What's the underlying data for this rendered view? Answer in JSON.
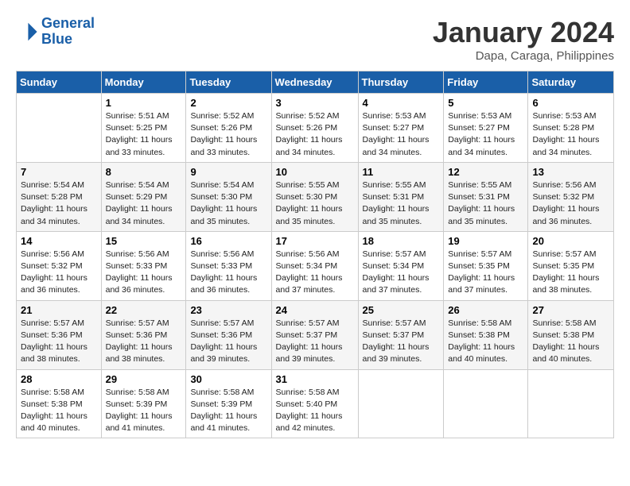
{
  "header": {
    "logo_line1": "General",
    "logo_line2": "Blue",
    "month": "January 2024",
    "location": "Dapa, Caraga, Philippines"
  },
  "days_of_week": [
    "Sunday",
    "Monday",
    "Tuesday",
    "Wednesday",
    "Thursday",
    "Friday",
    "Saturday"
  ],
  "weeks": [
    [
      {
        "day": "",
        "info": ""
      },
      {
        "day": "1",
        "info": "Sunrise: 5:51 AM\nSunset: 5:25 PM\nDaylight: 11 hours\nand 33 minutes."
      },
      {
        "day": "2",
        "info": "Sunrise: 5:52 AM\nSunset: 5:26 PM\nDaylight: 11 hours\nand 33 minutes."
      },
      {
        "day": "3",
        "info": "Sunrise: 5:52 AM\nSunset: 5:26 PM\nDaylight: 11 hours\nand 34 minutes."
      },
      {
        "day": "4",
        "info": "Sunrise: 5:53 AM\nSunset: 5:27 PM\nDaylight: 11 hours\nand 34 minutes."
      },
      {
        "day": "5",
        "info": "Sunrise: 5:53 AM\nSunset: 5:27 PM\nDaylight: 11 hours\nand 34 minutes."
      },
      {
        "day": "6",
        "info": "Sunrise: 5:53 AM\nSunset: 5:28 PM\nDaylight: 11 hours\nand 34 minutes."
      }
    ],
    [
      {
        "day": "7",
        "info": "Sunrise: 5:54 AM\nSunset: 5:28 PM\nDaylight: 11 hours\nand 34 minutes."
      },
      {
        "day": "8",
        "info": "Sunrise: 5:54 AM\nSunset: 5:29 PM\nDaylight: 11 hours\nand 34 minutes."
      },
      {
        "day": "9",
        "info": "Sunrise: 5:54 AM\nSunset: 5:30 PM\nDaylight: 11 hours\nand 35 minutes."
      },
      {
        "day": "10",
        "info": "Sunrise: 5:55 AM\nSunset: 5:30 PM\nDaylight: 11 hours\nand 35 minutes."
      },
      {
        "day": "11",
        "info": "Sunrise: 5:55 AM\nSunset: 5:31 PM\nDaylight: 11 hours\nand 35 minutes."
      },
      {
        "day": "12",
        "info": "Sunrise: 5:55 AM\nSunset: 5:31 PM\nDaylight: 11 hours\nand 35 minutes."
      },
      {
        "day": "13",
        "info": "Sunrise: 5:56 AM\nSunset: 5:32 PM\nDaylight: 11 hours\nand 36 minutes."
      }
    ],
    [
      {
        "day": "14",
        "info": "Sunrise: 5:56 AM\nSunset: 5:32 PM\nDaylight: 11 hours\nand 36 minutes."
      },
      {
        "day": "15",
        "info": "Sunrise: 5:56 AM\nSunset: 5:33 PM\nDaylight: 11 hours\nand 36 minutes."
      },
      {
        "day": "16",
        "info": "Sunrise: 5:56 AM\nSunset: 5:33 PM\nDaylight: 11 hours\nand 36 minutes."
      },
      {
        "day": "17",
        "info": "Sunrise: 5:56 AM\nSunset: 5:34 PM\nDaylight: 11 hours\nand 37 minutes."
      },
      {
        "day": "18",
        "info": "Sunrise: 5:57 AM\nSunset: 5:34 PM\nDaylight: 11 hours\nand 37 minutes."
      },
      {
        "day": "19",
        "info": "Sunrise: 5:57 AM\nSunset: 5:35 PM\nDaylight: 11 hours\nand 37 minutes."
      },
      {
        "day": "20",
        "info": "Sunrise: 5:57 AM\nSunset: 5:35 PM\nDaylight: 11 hours\nand 38 minutes."
      }
    ],
    [
      {
        "day": "21",
        "info": "Sunrise: 5:57 AM\nSunset: 5:36 PM\nDaylight: 11 hours\nand 38 minutes."
      },
      {
        "day": "22",
        "info": "Sunrise: 5:57 AM\nSunset: 5:36 PM\nDaylight: 11 hours\nand 38 minutes."
      },
      {
        "day": "23",
        "info": "Sunrise: 5:57 AM\nSunset: 5:36 PM\nDaylight: 11 hours\nand 39 minutes."
      },
      {
        "day": "24",
        "info": "Sunrise: 5:57 AM\nSunset: 5:37 PM\nDaylight: 11 hours\nand 39 minutes."
      },
      {
        "day": "25",
        "info": "Sunrise: 5:57 AM\nSunset: 5:37 PM\nDaylight: 11 hours\nand 39 minutes."
      },
      {
        "day": "26",
        "info": "Sunrise: 5:58 AM\nSunset: 5:38 PM\nDaylight: 11 hours\nand 40 minutes."
      },
      {
        "day": "27",
        "info": "Sunrise: 5:58 AM\nSunset: 5:38 PM\nDaylight: 11 hours\nand 40 minutes."
      }
    ],
    [
      {
        "day": "28",
        "info": "Sunrise: 5:58 AM\nSunset: 5:38 PM\nDaylight: 11 hours\nand 40 minutes."
      },
      {
        "day": "29",
        "info": "Sunrise: 5:58 AM\nSunset: 5:39 PM\nDaylight: 11 hours\nand 41 minutes."
      },
      {
        "day": "30",
        "info": "Sunrise: 5:58 AM\nSunset: 5:39 PM\nDaylight: 11 hours\nand 41 minutes."
      },
      {
        "day": "31",
        "info": "Sunrise: 5:58 AM\nSunset: 5:40 PM\nDaylight: 11 hours\nand 42 minutes."
      },
      {
        "day": "",
        "info": ""
      },
      {
        "day": "",
        "info": ""
      },
      {
        "day": "",
        "info": ""
      }
    ]
  ]
}
